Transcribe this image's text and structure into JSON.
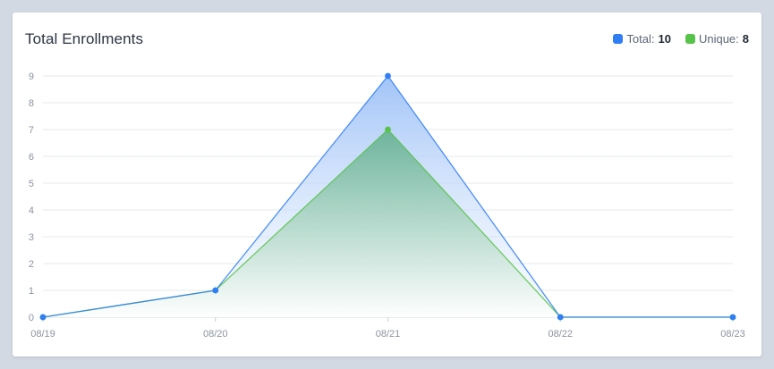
{
  "card": {
    "title": "Total Enrollments",
    "legend": [
      {
        "label": "Total:",
        "value": "10",
        "color": "#2f7ef5"
      },
      {
        "label": "Unique:",
        "value": "8",
        "color": "#58c34a"
      }
    ]
  },
  "chart_data": {
    "type": "area",
    "categories": [
      "08/19",
      "08/20",
      "08/21",
      "08/22",
      "08/23"
    ],
    "series": [
      {
        "name": "Total",
        "values": [
          0,
          1,
          9,
          0,
          0
        ],
        "color": "#2f7ef5"
      },
      {
        "name": "Unique",
        "values": [
          0,
          1,
          7,
          0,
          0
        ],
        "color": "#58c34a"
      }
    ],
    "yticks": [
      0,
      1,
      2,
      3,
      4,
      5,
      6,
      7,
      8,
      9
    ],
    "ylim": [
      0,
      9
    ],
    "grid": true,
    "legend_position": "top-right"
  }
}
